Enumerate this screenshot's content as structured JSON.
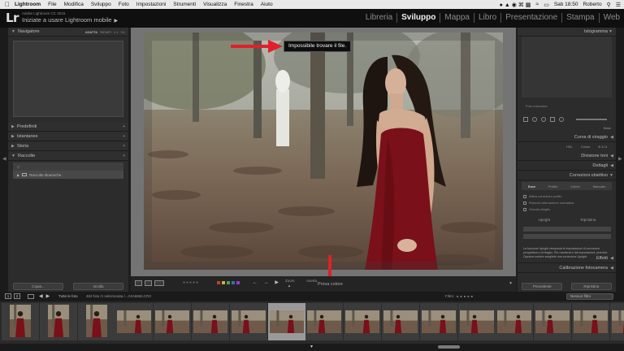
{
  "menubar": {
    "app": "Lightroom",
    "items": [
      "File",
      "Modifica",
      "Sviluppo",
      "Foto",
      "Impostazioni",
      "Strumenti",
      "Visualizza",
      "Finestra",
      "Aiuto"
    ],
    "clock": "Sab 18:50",
    "user": "Roberto"
  },
  "identity": {
    "logo": "Lr",
    "version": "Adobe Lightroom CC 2015",
    "mobile": "Iniziate a usare Lightroom mobile"
  },
  "modules": [
    "Libreria",
    "Sviluppo",
    "Mappa",
    "Libro",
    "Presentazione",
    "Stampa",
    "Web"
  ],
  "active_module": "Sviluppo",
  "left_panel": {
    "navigator": "Navigatore",
    "zoom": [
      "ADATTA",
      "RIEMPI",
      "1:1",
      "3:1"
    ],
    "presets": "Predefiniti",
    "snapshots": "Istantanee",
    "history": "Storia",
    "collections": "Raccolte",
    "smart_collection": "Raccolte dinamiche",
    "copy_btn": "Copia...",
    "paste_btn": "Incolla"
  },
  "right_panel": {
    "histogram": "Istogramma",
    "photo_status": "Foto mancante",
    "basic": "Base",
    "tone_curve": "Curva di viraggio",
    "hsl": [
      "HSL",
      "Colore",
      "B & N"
    ],
    "split_toning": "Divisione toni",
    "detail": "Dettagli",
    "lens_corrections": "Correzioni obiettivo",
    "lens_tabs": [
      "Base",
      "Profilo",
      "Colore",
      "Manuale"
    ],
    "lens_checks": [
      "Attiva correzioni profilo",
      "Rimuovi aberrazione cromatica",
      "Vincola ritaglio"
    ],
    "upright_label": "Upright",
    "reset_label": "Ripristina",
    "notice": "La funzione Upright reimposta le impostazioni di correzione prospettica e di ritaglio. Per mantenere tali impostazioni, premete Opzione mentre scegliete una correzione Upright.",
    "effects": "Effetti",
    "calibration": "Calibrazione fotocamera",
    "previous_btn": "Precedente",
    "reset_btn": "Ripristina"
  },
  "photo": {
    "tooltip": "Impossibile trovare il file."
  },
  "toolbar": {
    "zoom": "Zoom",
    "add": "Aserta",
    "color_probe": "Prova colore"
  },
  "filmstrip_bar": {
    "page_nums": [
      "1",
      "2"
    ],
    "source": "Tutte le foto",
    "selection": "463 foto /1 selezionata /...r/4A6684.CR2",
    "filter_label": "Filtro:",
    "filter_value": "Nessun filtro"
  },
  "colors": {
    "red_dress": "#7a1019",
    "annotation_red": "#e0202a",
    "panel_bg": "#2c2c2c",
    "center_bg": "#747474"
  }
}
